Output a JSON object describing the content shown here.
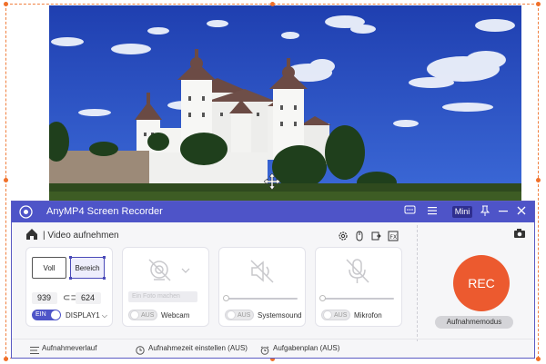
{
  "app": {
    "title": "AnyMP4 Screen Recorder",
    "mini_label": "Mini",
    "accent_color": "#4e54c8",
    "rec_color": "#ec5a2f"
  },
  "toolbar": {
    "home_icon": "home-icon",
    "mode_label": "| Video aufnehmen",
    "icons": [
      "gear-icon",
      "mouse-icon",
      "export-icon",
      "fx-icon"
    ],
    "camera_icon": "camera-icon"
  },
  "display_panel": {
    "full_label": "Voll",
    "region_label": "Bereich",
    "width": "939",
    "height": "624",
    "toggle_label": "EIN",
    "display_label": "DISPLAY1"
  },
  "webcam_panel": {
    "photo_label": "Ein Foto machen",
    "toggle_label": "AUS",
    "label": "Webcam"
  },
  "sound_panel": {
    "toggle_label": "AUS",
    "label": "Systemsound",
    "volume": 0
  },
  "mic_panel": {
    "toggle_label": "AUS",
    "label": "Mikrofon",
    "volume": 0
  },
  "record": {
    "rec_label": "REC",
    "mode_button": "Aufnahmemodus"
  },
  "bottom_bar": {
    "history": "Aufnahmeverlauf",
    "timer": "Aufnahmezeit einstellen (AUS)",
    "schedule": "Aufgabenplan (AUS)"
  }
}
